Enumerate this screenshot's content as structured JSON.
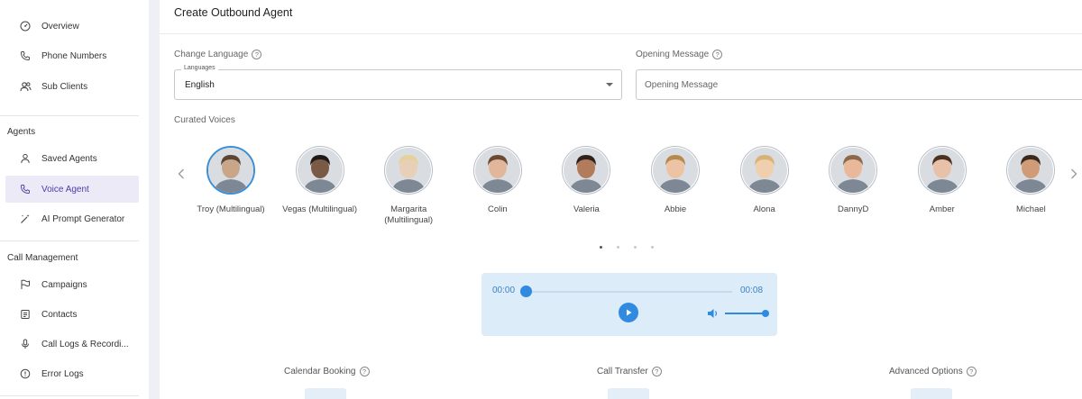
{
  "sidebar": {
    "items": [
      {
        "label": "Overview",
        "icon": "dashboard-icon"
      },
      {
        "label": "Phone Numbers",
        "icon": "phone-icon"
      },
      {
        "label": "Sub Clients",
        "icon": "users-icon"
      }
    ],
    "sections": [
      {
        "title": "Agents",
        "items": [
          {
            "label": "Saved Agents",
            "icon": "user-icon"
          },
          {
            "label": "Voice Agent",
            "icon": "phone-icon",
            "active": true
          },
          {
            "label": "AI Prompt Generator",
            "icon": "magic-wand-icon"
          }
        ]
      },
      {
        "title": "Call Management",
        "items": [
          {
            "label": "Campaigns",
            "icon": "flag-icon"
          },
          {
            "label": "Contacts",
            "icon": "contacts-icon"
          },
          {
            "label": "Call Logs & Recordi...",
            "icon": "microphone-icon"
          },
          {
            "label": "Error Logs",
            "icon": "alert-circle-icon"
          }
        ]
      }
    ]
  },
  "page": {
    "title": "Create Outbound Agent"
  },
  "language": {
    "label": "Change Language",
    "legend": "Languages",
    "value": "English"
  },
  "opening_message": {
    "label": "Opening Message",
    "placeholder": "Opening Message",
    "value": ""
  },
  "voices": {
    "label": "Curated Voices",
    "items": [
      {
        "name": "Troy (Multilingual)",
        "selected": true
      },
      {
        "name": "Vegas (Multilingual)"
      },
      {
        "name": "Margarita (Multilingual)"
      },
      {
        "name": "Colin"
      },
      {
        "name": "Valeria"
      },
      {
        "name": "Abbie"
      },
      {
        "name": "Alona"
      },
      {
        "name": "DannyD"
      },
      {
        "name": "Amber"
      },
      {
        "name": "Michael"
      }
    ],
    "page_count": 4,
    "current_page": 1
  },
  "player": {
    "current_time": "00:00",
    "duration": "00:08",
    "progress": 0,
    "volume": 1
  },
  "options": [
    {
      "label": "Calendar Booking"
    },
    {
      "label": "Call Transfer"
    },
    {
      "label": "Advanced Options"
    }
  ],
  "colors": {
    "accent": "#2f8ae0",
    "active_nav_bg": "#eceaf6",
    "player_bg": "#dcecf9"
  }
}
